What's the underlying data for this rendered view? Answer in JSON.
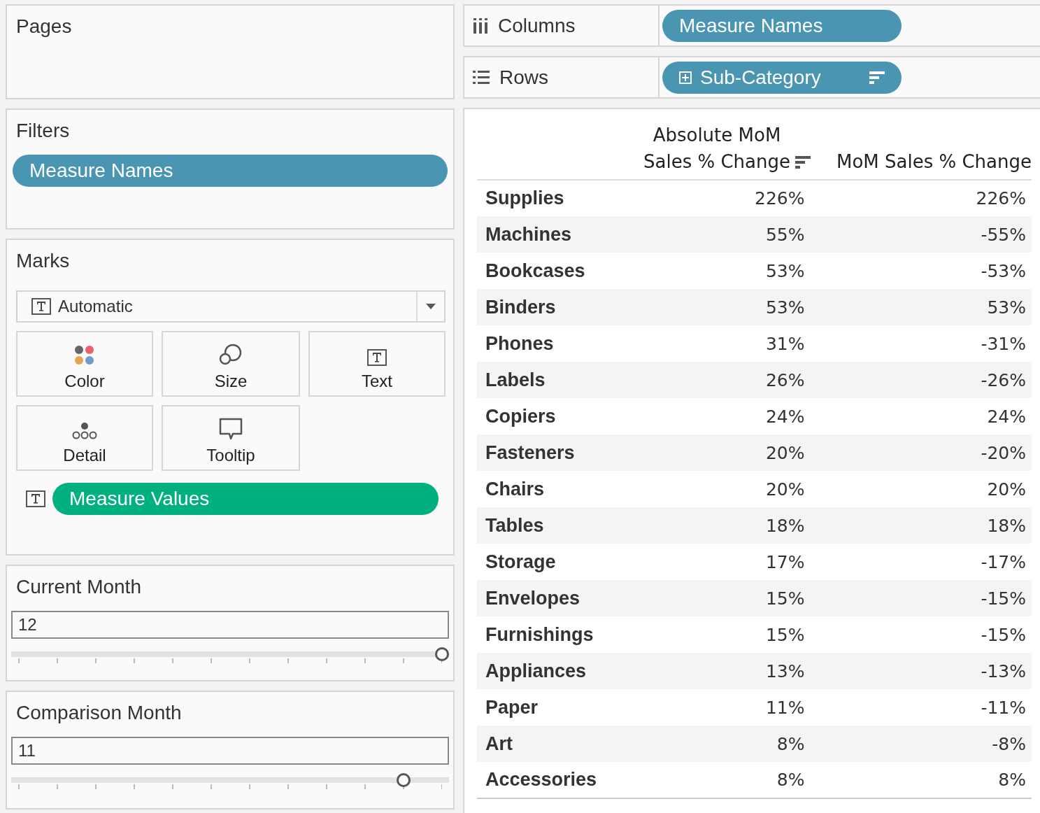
{
  "pages": {
    "title": "Pages"
  },
  "filters": {
    "title": "Filters",
    "pills": [
      "Measure Names"
    ]
  },
  "marks": {
    "title": "Marks",
    "mark_type": "Automatic",
    "cards": [
      {
        "kind": "color",
        "label": "Color"
      },
      {
        "kind": "size",
        "label": "Size"
      },
      {
        "kind": "text",
        "label": "Text"
      },
      {
        "kind": "detail",
        "label": "Detail"
      },
      {
        "kind": "tooltip",
        "label": "Tooltip"
      }
    ],
    "fields": [
      {
        "kind": "text",
        "label": "Measure Values"
      }
    ]
  },
  "parameters": [
    {
      "title": "Current Month",
      "value": "12",
      "level": 1
    },
    {
      "title": "Comparison Month",
      "value": "11",
      "level": 0.91
    }
  ],
  "shelves": [
    {
      "kind": "columns",
      "label": "Columns",
      "pills": [
        {
          "label": "Measure Names",
          "expand": false,
          "sorted": false
        }
      ]
    },
    {
      "kind": "rows",
      "label": "Rows",
      "pills": [
        {
          "label": "Sub-Category",
          "expand": true,
          "sorted": true
        }
      ]
    }
  ],
  "table": {
    "columns": [
      {
        "kind": "row_header"
      },
      {
        "kind": "measure",
        "label": "Absolute MoM Sales % Change",
        "sorted": true
      },
      {
        "kind": "measure",
        "label": "MoM Sales % Change"
      }
    ],
    "rows": [
      [
        "Supplies",
        "226%",
        "226%"
      ],
      [
        "Machines",
        "55%",
        "-55%"
      ],
      [
        "Bookcases",
        "53%",
        "-53%"
      ],
      [
        "Binders",
        "53%",
        "53%"
      ],
      [
        "Phones",
        "31%",
        "-31%"
      ],
      [
        "Labels",
        "26%",
        "-26%"
      ],
      [
        "Copiers",
        "24%",
        "24%"
      ],
      [
        "Fasteners",
        "20%",
        "-20%"
      ],
      [
        "Chairs",
        "20%",
        "20%"
      ],
      [
        "Tables",
        "18%",
        "18%"
      ],
      [
        "Storage",
        "17%",
        "-17%"
      ],
      [
        "Envelopes",
        "15%",
        "-15%"
      ],
      [
        "Furnishings",
        "15%",
        "-15%"
      ],
      [
        "Appliances",
        "13%",
        "-13%"
      ],
      [
        "Paper",
        "11%",
        "-11%"
      ],
      [
        "Art",
        "8%",
        "-8%"
      ],
      [
        "Accessories",
        "8%",
        "8%"
      ]
    ]
  }
}
